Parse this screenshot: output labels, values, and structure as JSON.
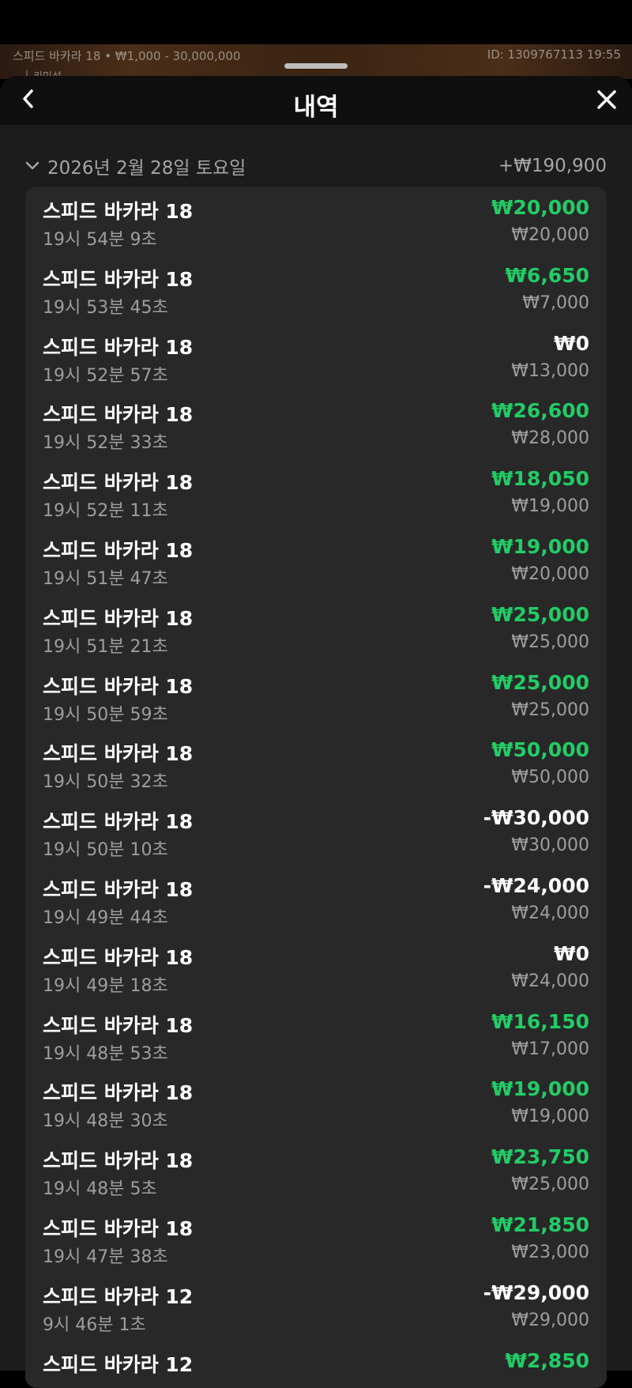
{
  "game": {
    "info": "스피드 바카라 18 • ₩1,000 - 30,000,000",
    "id": "ID: 1309767113 19:55",
    "sub": "└ 키민석"
  },
  "sheet": {
    "title": "내역",
    "back_icon": "chevron-left-icon",
    "close_icon": "close-icon"
  },
  "day": {
    "date": "2026년 2월 28일 토요일",
    "total": "+₩190,900"
  },
  "colors": {
    "win": "#22cc66",
    "neutral": "#ffffff",
    "muted": "#9e9e9e",
    "card": "#282828"
  },
  "rows": [
    {
      "name": "스피드 바카라 18",
      "time": "19시 54분 9초",
      "result": "₩20,000",
      "bet": "₩20,000",
      "color": "green"
    },
    {
      "name": "스피드 바카라 18",
      "time": "19시 53분 45초",
      "result": "₩6,650",
      "bet": "₩7,000",
      "color": "green"
    },
    {
      "name": "스피드 바카라 18",
      "time": "19시 52분 57초",
      "result": "₩0",
      "bet": "₩13,000",
      "color": "white"
    },
    {
      "name": "스피드 바카라 18",
      "time": "19시 52분 33초",
      "result": "₩26,600",
      "bet": "₩28,000",
      "color": "green"
    },
    {
      "name": "스피드 바카라 18",
      "time": "19시 52분 11초",
      "result": "₩18,050",
      "bet": "₩19,000",
      "color": "green"
    },
    {
      "name": "스피드 바카라 18",
      "time": "19시 51분 47초",
      "result": "₩19,000",
      "bet": "₩20,000",
      "color": "green"
    },
    {
      "name": "스피드 바카라 18",
      "time": "19시 51분 21초",
      "result": "₩25,000",
      "bet": "₩25,000",
      "color": "green"
    },
    {
      "name": "스피드 바카라 18",
      "time": "19시 50분 59초",
      "result": "₩25,000",
      "bet": "₩25,000",
      "color": "green"
    },
    {
      "name": "스피드 바카라 18",
      "time": "19시 50분 32초",
      "result": "₩50,000",
      "bet": "₩50,000",
      "color": "green"
    },
    {
      "name": "스피드 바카라 18",
      "time": "19시 50분 10초",
      "result": "-₩30,000",
      "bet": "₩30,000",
      "color": "white"
    },
    {
      "name": "스피드 바카라 18",
      "time": "19시 49분 44초",
      "result": "-₩24,000",
      "bet": "₩24,000",
      "color": "white"
    },
    {
      "name": "스피드 바카라 18",
      "time": "19시 49분 18초",
      "result": "₩0",
      "bet": "₩24,000",
      "color": "white"
    },
    {
      "name": "스피드 바카라 18",
      "time": "19시 48분 53초",
      "result": "₩16,150",
      "bet": "₩17,000",
      "color": "green"
    },
    {
      "name": "스피드 바카라 18",
      "time": "19시 48분 30초",
      "result": "₩19,000",
      "bet": "₩19,000",
      "color": "green"
    },
    {
      "name": "스피드 바카라 18",
      "time": "19시 48분 5초",
      "result": "₩23,750",
      "bet": "₩25,000",
      "color": "green"
    },
    {
      "name": "스피드 바카라 18",
      "time": "19시 47분 38초",
      "result": "₩21,850",
      "bet": "₩23,000",
      "color": "green"
    },
    {
      "name": "스피드 바카라 12",
      "time": "9시 46분 1초",
      "result": "-₩29,000",
      "bet": "₩29,000",
      "color": "white"
    },
    {
      "name": "스피드 바카라 12",
      "time": "",
      "result": "₩2,850",
      "bet": "",
      "color": "green"
    }
  ]
}
